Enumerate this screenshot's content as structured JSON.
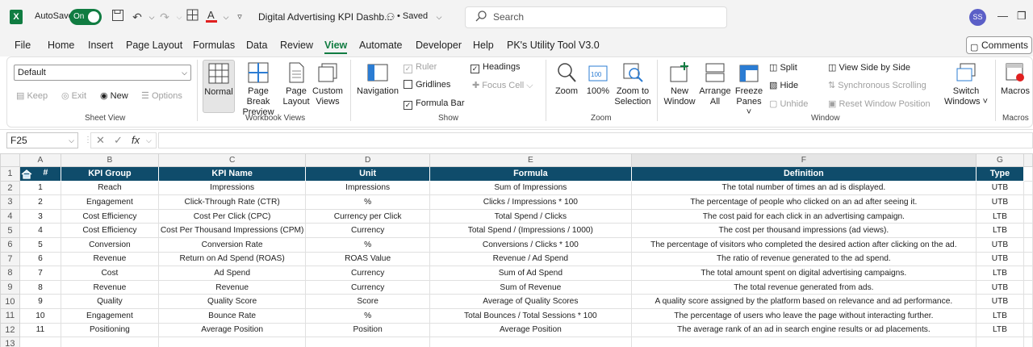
{
  "titlebar": {
    "autosave_label": "AutoSave",
    "autosave_state": "On",
    "doc_title": "Digital Advertising KPI Dashb...",
    "saved_label": "• Saved",
    "search_placeholder": "Search",
    "user_initials": "SS"
  },
  "menu": {
    "items": [
      "File",
      "Home",
      "Insert",
      "Page Layout",
      "Formulas",
      "Data",
      "Review",
      "View",
      "Automate",
      "Developer",
      "Help",
      "PK's Utility Tool V3.0"
    ],
    "active": "View",
    "comments_label": "Comments"
  },
  "ribbon": {
    "sheet_view": {
      "combo_value": "Default",
      "keep": "Keep",
      "exit": "Exit",
      "new": "New",
      "options": "Options",
      "label": "Sheet View"
    },
    "workbook_views": {
      "normal": "Normal",
      "page_break_1": "Page Break",
      "page_break_2": "Preview",
      "page_layout_1": "Page",
      "page_layout_2": "Layout",
      "custom_views_1": "Custom",
      "custom_views_2": "Views",
      "label": "Workbook Views"
    },
    "show": {
      "navigation": "Navigation",
      "ruler": "Ruler",
      "gridlines": "Gridlines",
      "formula_bar": "Formula Bar",
      "headings": "Headings",
      "focus_cell": "Focus Cell",
      "label": "Show"
    },
    "zoom": {
      "zoom": "Zoom",
      "pct100": "100%",
      "zoom_sel_1": "Zoom to",
      "zoom_sel_2": "Selection",
      "label": "Zoom"
    },
    "window": {
      "new_window_1": "New",
      "new_window_2": "Window",
      "arrange_1": "Arrange",
      "arrange_2": "All",
      "freeze_1": "Freeze",
      "freeze_2": "Panes ˅",
      "split": "Split",
      "hide": "Hide",
      "unhide": "Unhide",
      "side_by_side": "View Side by Side",
      "sync_scroll": "Synchronous Scrolling",
      "reset_pos": "Reset Window Position",
      "switch_1": "Switch",
      "switch_2": "Windows ˅",
      "label": "Window"
    },
    "macros": {
      "macros": "Macros",
      "label": "Macros"
    }
  },
  "formula_bar": {
    "name_box": "F25",
    "fx": "fx",
    "formula": ""
  },
  "sheet": {
    "columns": [
      "A",
      "B",
      "C",
      "D",
      "E",
      "F",
      "G"
    ],
    "selected_column": "F",
    "header_row": [
      "#",
      "KPI Group",
      "KPI Name",
      "Unit",
      "Formula",
      "Definition",
      "Type"
    ],
    "rows": [
      [
        "1",
        "Reach",
        "Impressions",
        "Impressions",
        "Sum of Impressions",
        "The total number of times an ad is displayed.",
        "UTB"
      ],
      [
        "2",
        "Engagement",
        "Click-Through Rate (CTR)",
        "%",
        "Clicks / Impressions * 100",
        "The percentage of people who clicked on an ad after seeing it.",
        "UTB"
      ],
      [
        "3",
        "Cost Efficiency",
        "Cost Per Click (CPC)",
        "Currency per Click",
        "Total Spend / Clicks",
        "The cost paid for each click in an advertising campaign.",
        "LTB"
      ],
      [
        "4",
        "Cost Efficiency",
        "Cost Per Thousand Impressions (CPM)",
        "Currency",
        "Total Spend / (Impressions / 1000)",
        "The cost per thousand impressions (ad views).",
        "LTB"
      ],
      [
        "5",
        "Conversion",
        "Conversion Rate",
        "%",
        "Conversions / Clicks * 100",
        "The percentage of visitors who completed the desired action after clicking on the ad.",
        "UTB"
      ],
      [
        "6",
        "Revenue",
        "Return on Ad Spend (ROAS)",
        "ROAS Value",
        "Revenue / Ad Spend",
        "The ratio of revenue generated to the ad spend.",
        "UTB"
      ],
      [
        "7",
        "Cost",
        "Ad Spend",
        "Currency",
        "Sum of Ad Spend",
        "The total amount spent on digital advertising campaigns.",
        "LTB"
      ],
      [
        "8",
        "Revenue",
        "Revenue",
        "Currency",
        "Sum of Revenue",
        "The total revenue generated from ads.",
        "UTB"
      ],
      [
        "9",
        "Quality",
        "Quality Score",
        "Score",
        "Average of Quality Scores",
        "A quality score assigned by the platform based on relevance and ad performance.",
        "UTB"
      ],
      [
        "10",
        "Engagement",
        "Bounce Rate",
        "%",
        "Total Bounces / Total Sessions * 100",
        "The percentage of users who leave the page without interacting further.",
        "LTB"
      ],
      [
        "11",
        "Positioning",
        "Average Position",
        "Position",
        "Average Position",
        "The average rank of an ad in search engine results or ad placements.",
        "LTB"
      ]
    ],
    "row_numbers": [
      "1",
      "2",
      "3",
      "4",
      "5",
      "6",
      "7",
      "8",
      "9",
      "10",
      "11",
      "12",
      "13"
    ],
    "colors": {
      "header_bg": "#0f4c6b",
      "accent": "#107c41"
    }
  }
}
